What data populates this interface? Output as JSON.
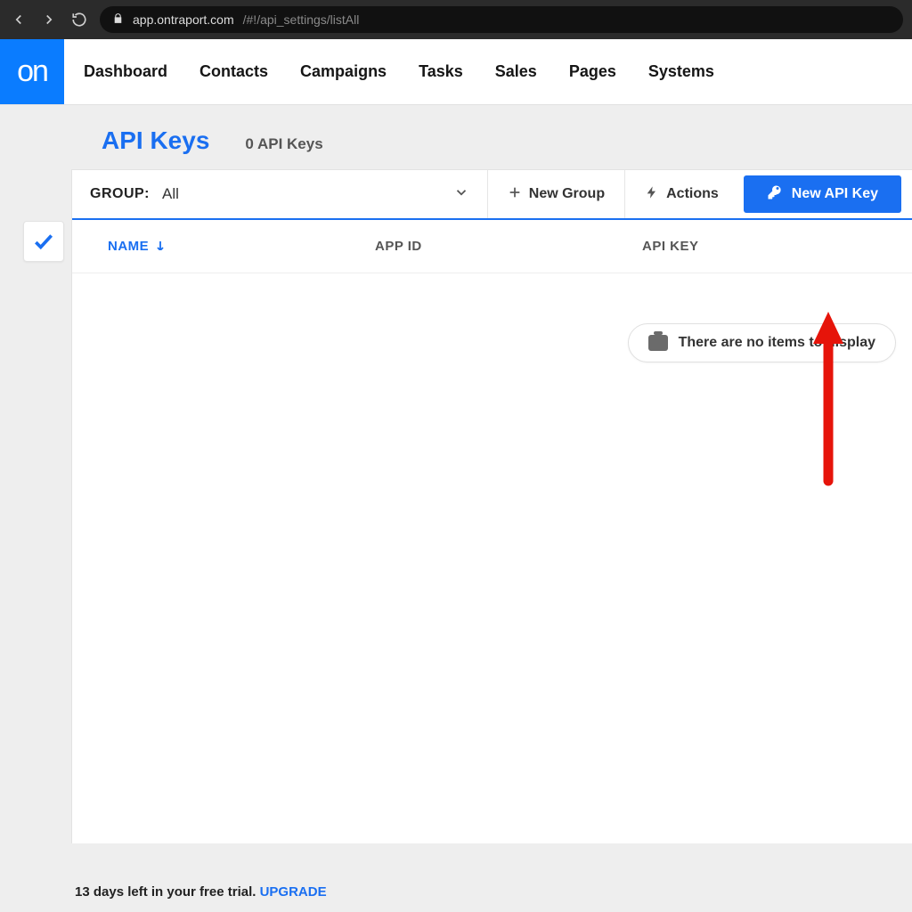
{
  "browser": {
    "url_host": "app.ontraport.com",
    "url_path": "/#!/api_settings/listAll"
  },
  "logo_text": "on",
  "nav": {
    "items": [
      "Dashboard",
      "Contacts",
      "Campaigns",
      "Tasks",
      "Sales",
      "Pages",
      "Systems"
    ]
  },
  "page": {
    "title": "API Keys",
    "count_text": "0 API Keys"
  },
  "toolbar": {
    "group_label": "GROUP:",
    "group_value": "All",
    "new_group": "New Group",
    "actions": "Actions",
    "new_key": "New API Key"
  },
  "columns": {
    "name": "NAME",
    "app_id": "APP ID",
    "api_key": "API KEY"
  },
  "empty_text": "There are no items to display",
  "footer": {
    "trial_text": "13 days left in your free trial. ",
    "upgrade": "UPGRADE"
  }
}
